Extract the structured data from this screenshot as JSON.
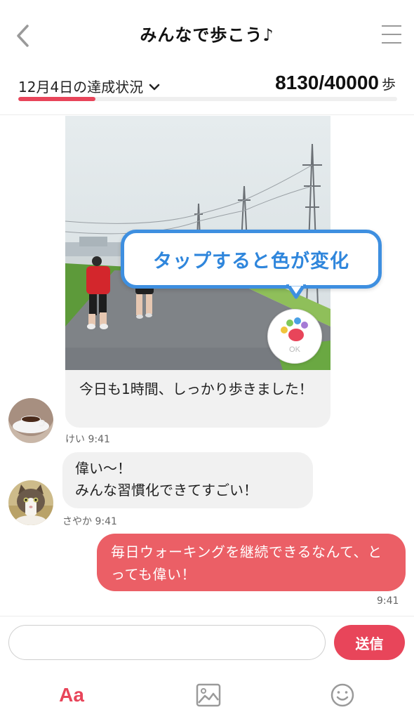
{
  "header": {
    "title": "みんなで歩こう♪",
    "back_icon": "chevron-left-icon",
    "menu_icon": "hamburger-menu-icon"
  },
  "progress": {
    "date_label": "12月4日の達成状況",
    "steps_value": "8130/40000",
    "steps_unit": "歩",
    "current_steps": 8130,
    "goal_steps": 40000,
    "bar_color": "#e8455a"
  },
  "messages": {
    "photo_post": {
      "callout_text": "タップすると色が変化",
      "reaction_label": "OK",
      "caption": "今日も1時間、しっかり歩きました！",
      "sender": "けい",
      "time": "9:41"
    },
    "reply": {
      "line1": "偉い〜！",
      "line2": "みんな習慣化できてすごい！",
      "sender": "さやか",
      "time": "9:41"
    },
    "own": {
      "text": "毎日ウォーキングを継続できるなんて、とっても偉い！",
      "time": "9:41",
      "bubble_color": "#eb5f66"
    }
  },
  "composer": {
    "placeholder": "",
    "send_label": "送信"
  },
  "tabs": {
    "text_label": "Aa",
    "image_icon": "image-icon",
    "emoji_icon": "smiley-icon"
  }
}
